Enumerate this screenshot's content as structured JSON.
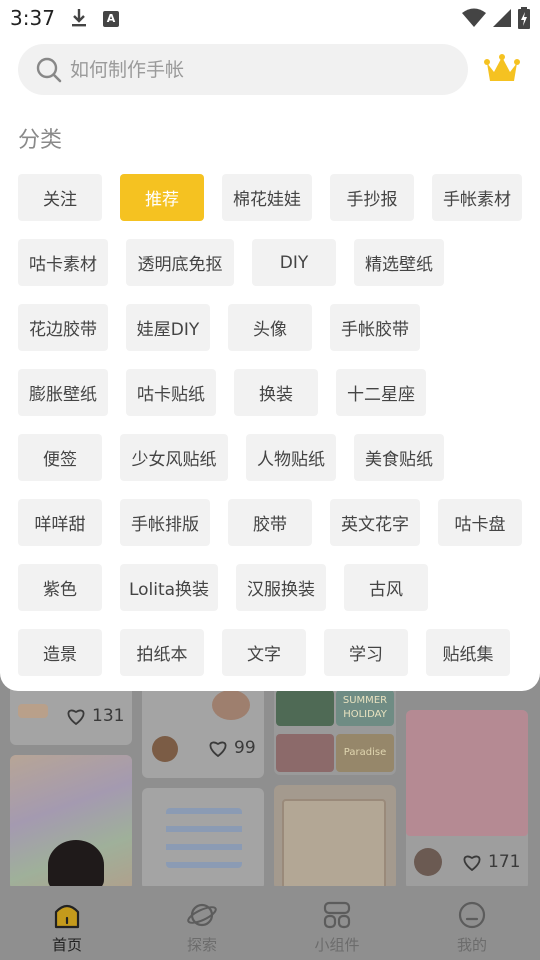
{
  "status_bar": {
    "time": "3:37"
  },
  "search": {
    "placeholder": "如何制作手帐"
  },
  "section_title": "分类",
  "categories": [
    "关注",
    "推荐",
    "棉花娃娃",
    "手抄报",
    "手帐素材",
    "咕卡素材",
    "透明底免抠",
    "DIY",
    "精选壁纸",
    "花边胶带",
    "娃屋DIY",
    "头像",
    "手帐胶带",
    "膨胀壁纸",
    "咕卡贴纸",
    "换装",
    "十二星座",
    "便签",
    "少女风贴纸",
    "人物贴纸",
    "美食贴纸",
    "咩咩甜",
    "手帐排版",
    "胶带",
    "英文花字",
    "咕卡盘",
    "紫色",
    "Lolita换装",
    "汉服换装",
    "古风",
    "造景",
    "拍纸本",
    "文字",
    "学习",
    "贴纸集"
  ],
  "selected_category": "推荐",
  "feed": {
    "likes": [
      "131",
      "99",
      "171"
    ],
    "sticker_texts": [
      "SUMMER",
      "HOLIDAY",
      "Paradise"
    ]
  },
  "bottom_nav": [
    {
      "label": "首页",
      "icon": "home-icon"
    },
    {
      "label": "探索",
      "icon": "planet-icon"
    },
    {
      "label": "小组件",
      "icon": "widgets-icon"
    },
    {
      "label": "我的",
      "icon": "profile-icon"
    }
  ],
  "colors": {
    "accent": "#f5c221",
    "chip_bg": "#f2f2f2",
    "crown": "#f5c221"
  }
}
